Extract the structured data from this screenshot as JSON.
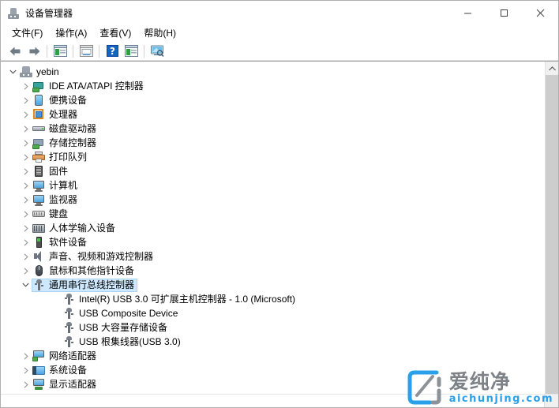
{
  "window": {
    "title": "设备管理器",
    "icon": "device-manager-icon",
    "controls": {
      "minimize": "最小化",
      "maximize": "最大化",
      "close": "关闭"
    }
  },
  "menubar": {
    "items": [
      {
        "label": "文件(F)",
        "text": "文件",
        "accel": "F",
        "name": "menu-file"
      },
      {
        "label": "操作(A)",
        "text": "操作",
        "accel": "A",
        "name": "menu-action"
      },
      {
        "label": "查看(V)",
        "text": "查看",
        "accel": "V",
        "name": "menu-view"
      },
      {
        "label": "帮助(H)",
        "text": "帮助",
        "accel": "H",
        "name": "menu-help"
      }
    ]
  },
  "toolbar": {
    "buttons": [
      {
        "icon": "back-arrow-icon",
        "tooltip": "后退"
      },
      {
        "icon": "forward-arrow-icon",
        "tooltip": "前进"
      },
      {
        "icon": "show-hide-console-tree-icon",
        "tooltip": "显示/隐藏控制台树"
      },
      {
        "icon": "properties-icon",
        "tooltip": "属性"
      },
      {
        "icon": "help-icon",
        "tooltip": "帮助"
      },
      {
        "icon": "update-driver-icon",
        "tooltip": "更新驱动程序"
      },
      {
        "icon": "scan-hardware-changes-icon",
        "tooltip": "扫描检测硬件改动"
      }
    ]
  },
  "tree": {
    "selected_index": 15,
    "nodes": [
      {
        "depth": 0,
        "label": "yebin",
        "expander": "expanded",
        "icon": "computer-root-icon"
      },
      {
        "depth": 1,
        "label": "IDE ATA/ATAPI 控制器",
        "expander": "collapsed",
        "icon": "ide-controller-icon"
      },
      {
        "depth": 1,
        "label": "便携设备",
        "expander": "collapsed",
        "icon": "portable-device-icon"
      },
      {
        "depth": 1,
        "label": "处理器",
        "expander": "collapsed",
        "icon": "processor-icon"
      },
      {
        "depth": 1,
        "label": "磁盘驱动器",
        "expander": "collapsed",
        "icon": "disk-drive-icon"
      },
      {
        "depth": 1,
        "label": "存储控制器",
        "expander": "collapsed",
        "icon": "storage-controller-icon"
      },
      {
        "depth": 1,
        "label": "打印队列",
        "expander": "collapsed",
        "icon": "print-queue-icon"
      },
      {
        "depth": 1,
        "label": "固件",
        "expander": "collapsed",
        "icon": "firmware-icon"
      },
      {
        "depth": 1,
        "label": "计算机",
        "expander": "collapsed",
        "icon": "computer-icon"
      },
      {
        "depth": 1,
        "label": "监视器",
        "expander": "collapsed",
        "icon": "monitor-icon"
      },
      {
        "depth": 1,
        "label": "键盘",
        "expander": "collapsed",
        "icon": "keyboard-icon"
      },
      {
        "depth": 1,
        "label": "人体学输入设备",
        "expander": "collapsed",
        "icon": "hid-device-icon"
      },
      {
        "depth": 1,
        "label": "软件设备",
        "expander": "collapsed",
        "icon": "software-device-icon"
      },
      {
        "depth": 1,
        "label": "声音、视频和游戏控制器",
        "expander": "collapsed",
        "icon": "sound-video-game-icon"
      },
      {
        "depth": 1,
        "label": "鼠标和其他指针设备",
        "expander": "collapsed",
        "icon": "mouse-icon"
      },
      {
        "depth": 1,
        "label": "通用串行总线控制器",
        "expander": "expanded",
        "icon": "usb-controller-icon"
      },
      {
        "depth": 2,
        "label": "Intel(R) USB 3.0 可扩展主机控制器 - 1.0 (Microsoft)",
        "expander": "none",
        "icon": "usb-device-icon"
      },
      {
        "depth": 2,
        "label": "USB Composite Device",
        "expander": "none",
        "icon": "usb-device-icon"
      },
      {
        "depth": 2,
        "label": "USB 大容量存储设备",
        "expander": "none",
        "icon": "usb-device-icon"
      },
      {
        "depth": 2,
        "label": "USB 根集线器(USB 3.0)",
        "expander": "none",
        "icon": "usb-device-icon"
      },
      {
        "depth": 1,
        "label": "网络适配器",
        "expander": "collapsed",
        "icon": "network-adapter-icon"
      },
      {
        "depth": 1,
        "label": "系统设备",
        "expander": "collapsed",
        "icon": "system-device-icon"
      },
      {
        "depth": 1,
        "label": "显示适配器",
        "expander": "collapsed",
        "icon": "display-adapter-icon"
      }
    ]
  },
  "scrollbars": {
    "vertical": {
      "up_arrow": "scroll-up-arrow-icon",
      "thumb_label": "垂直滚动条"
    },
    "horizontal": {
      "thumb_label": "水平滚动条"
    }
  },
  "watermark": {
    "brand_cn": "爱纯净",
    "brand_en": "aichunjing.com",
    "logo_color": "#2aa0e8",
    "text_color": "#7d8288"
  },
  "colors": {
    "selection": "#cde8ff",
    "selection_border": "#a8d4f2",
    "window_bg": "#ffffff",
    "scrollbar_track": "#f0f0f0",
    "scrollbar_thumb": "#cdcdcd"
  }
}
